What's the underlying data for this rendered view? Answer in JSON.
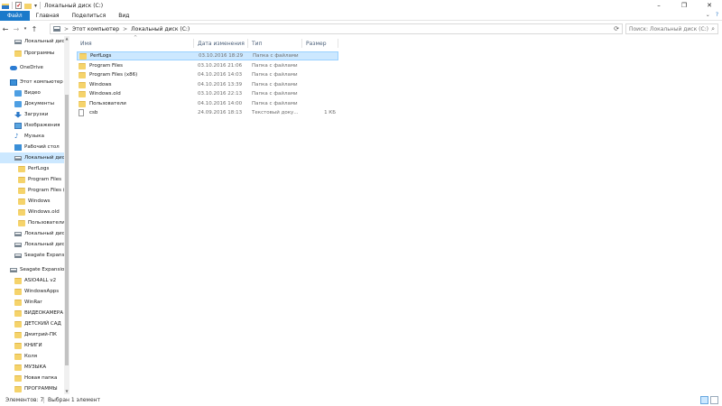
{
  "window": {
    "title": "Локальный диск (C:)",
    "controls": {
      "minimize": "–",
      "maximize": "❐",
      "close": "✕"
    }
  },
  "ribbon": {
    "tabs": [
      {
        "label": "Файл"
      },
      {
        "label": "Главная"
      },
      {
        "label": "Поделиться"
      },
      {
        "label": "Вид"
      }
    ],
    "expand_icon": "⌄",
    "help_icon": "?"
  },
  "address": {
    "crumbs": [
      "Этот компьютер",
      "Локальный диск (C:)"
    ],
    "separator": ">",
    "refresh_icon": "⟳"
  },
  "search": {
    "placeholder": "Поиск: Локальный диск (C:)",
    "icon": "⌕"
  },
  "nav": {
    "items": [
      {
        "label": "Локальный дис",
        "icon": "drive-icon"
      },
      {
        "label": "Программы",
        "icon": "folder-icon"
      },
      {
        "label": "OneDrive",
        "icon": "onedrive-icon"
      },
      {
        "label": "Этот компьютер",
        "icon": "computer-icon"
      },
      {
        "label": "Видео",
        "icon": "video-icon"
      },
      {
        "label": "Документы",
        "icon": "documents-icon"
      },
      {
        "label": "Загрузки",
        "icon": "downloads-icon"
      },
      {
        "label": "Изображения",
        "icon": "pictures-icon"
      },
      {
        "label": "Музыка",
        "icon": "music-icon"
      },
      {
        "label": "Рабочий стол",
        "icon": "desktop-icon"
      },
      {
        "label": "Локальный диск",
        "icon": "drive-icon",
        "selected": true
      },
      {
        "label": "PerfLogs",
        "icon": "folder-icon"
      },
      {
        "label": "Program Files",
        "icon": "folder-icon"
      },
      {
        "label": "Program Files (",
        "icon": "folder-icon"
      },
      {
        "label": "Windows",
        "icon": "folder-icon"
      },
      {
        "label": "Windows.old",
        "icon": "folder-icon"
      },
      {
        "label": "Пользователи",
        "icon": "folder-icon"
      },
      {
        "label": "Локальный дис",
        "icon": "drive-icon"
      },
      {
        "label": "Локальный дис",
        "icon": "drive-icon"
      },
      {
        "label": "Seagate Expansi",
        "icon": "drive-icon"
      },
      {
        "label": "Seagate Expansion",
        "icon": "drive-icon"
      },
      {
        "label": "ASIO4ALL v2",
        "icon": "folder-icon"
      },
      {
        "label": "WindowsApps",
        "icon": "folder-icon"
      },
      {
        "label": "WinRar",
        "icon": "folder-icon"
      },
      {
        "label": "ВИДЕОКАМЕРА",
        "icon": "folder-icon"
      },
      {
        "label": "ДЕТСКИЙ САД",
        "icon": "folder-icon"
      },
      {
        "label": "Дмитрий-ПК",
        "icon": "folder-icon"
      },
      {
        "label": "КНИГИ",
        "icon": "folder-icon"
      },
      {
        "label": "Коля",
        "icon": "folder-icon"
      },
      {
        "label": "МУЗЫКА",
        "icon": "folder-icon"
      },
      {
        "label": "Новая папка",
        "icon": "folder-icon"
      },
      {
        "label": "ПРОГРАММЫ",
        "icon": "folder-icon"
      }
    ]
  },
  "columns": {
    "name": "Имя",
    "date": "Дата изменения",
    "type": "Тип",
    "size": "Размер"
  },
  "files": [
    {
      "name": "PerfLogs",
      "date": "03.10.2016 18:29",
      "type": "Папка с файлами",
      "size": "",
      "icon": "folder-icon",
      "selected": true
    },
    {
      "name": "Program Files",
      "date": "03.10.2016 21:06",
      "type": "Папка с файлами",
      "size": "",
      "icon": "folder-icon"
    },
    {
      "name": "Program Files (x86)",
      "date": "04.10.2016 14:03",
      "type": "Папка с файлами",
      "size": "",
      "icon": "folder-icon"
    },
    {
      "name": "Windows",
      "date": "04.10.2016 13:39",
      "type": "Папка с файлами",
      "size": "",
      "icon": "folder-icon"
    },
    {
      "name": "Windows.old",
      "date": "03.10.2016 22:13",
      "type": "Папка с файлами",
      "size": "",
      "icon": "folder-icon"
    },
    {
      "name": "Пользователи",
      "date": "04.10.2016 14:00",
      "type": "Папка с файлами",
      "size": "",
      "icon": "folder-icon"
    },
    {
      "name": "csb",
      "date": "24.09.2016 18:13",
      "type": "Текстовый доку...",
      "size": "1 КБ",
      "icon": "text-file-icon"
    }
  ],
  "status": {
    "count": "Элементов: 7",
    "selected": "Выбран 1 элемент"
  }
}
